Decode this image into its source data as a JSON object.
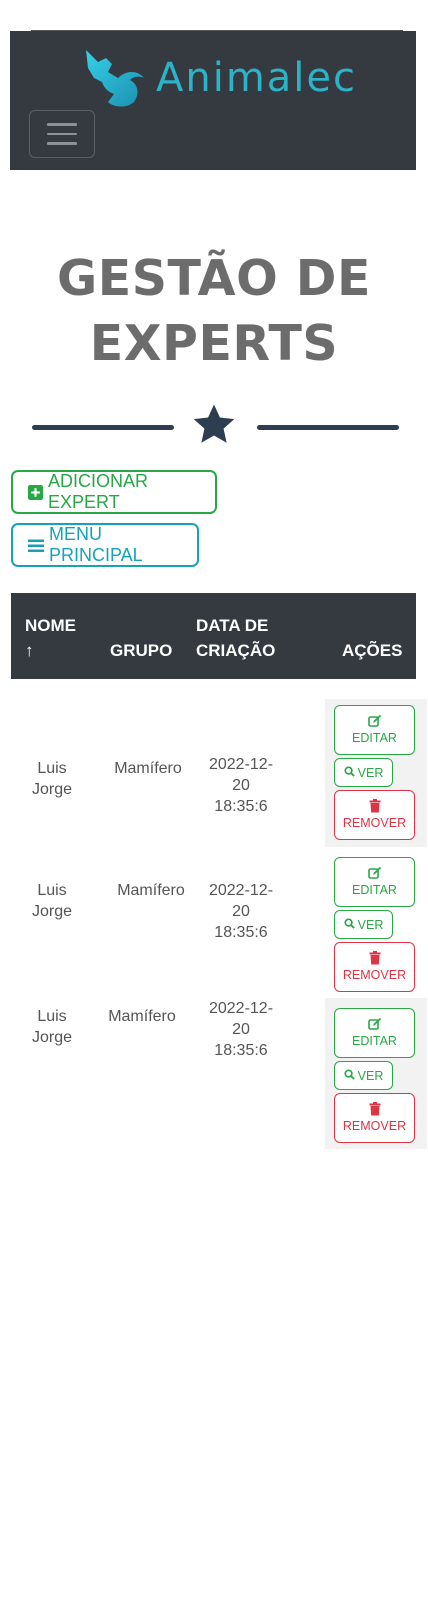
{
  "navbar": {
    "brand": "Animalec"
  },
  "title": {
    "line1": "GESTÃO DE",
    "line2": "EXPERTS"
  },
  "actions": {
    "add_label": "ADICIONAR EXPERT",
    "menu_label": "MENU PRINCIPAL"
  },
  "table": {
    "headers": {
      "nome_1": "NOME",
      "nome_arrow": "↑",
      "grupo": "GRUPO",
      "data_1": "DATA DE",
      "data_2": "CRIAÇÃO",
      "acoes": "AÇÕES"
    },
    "rows": [
      {
        "nome_1": "Luis",
        "nome_2": "Jorge",
        "grupo": "Mamífero",
        "date_1": "2022-12-",
        "date_2": "20",
        "date_3": "18:35:6"
      },
      {
        "nome_1": "Luis",
        "nome_2": "Jorge",
        "grupo": "Mamífero",
        "date_1": "2022-12-",
        "date_2": "20",
        "date_3": "18:35:6"
      },
      {
        "nome_1": "Luis",
        "nome_2": "Jorge",
        "grupo": "Mamífero",
        "date_1": "2022-12-",
        "date_2": "20",
        "date_3": "18:35:6"
      }
    ],
    "row_buttons": {
      "edit": "EDITAR",
      "view": "VER",
      "remove": "REMOVER"
    }
  },
  "colors": {
    "navbar": "#343a40",
    "brand": "#2bb3c8",
    "success": "#28a745",
    "info": "#17a2b8",
    "danger": "#dc3545",
    "star": "#2c3e50",
    "title": "#6c6c6c"
  },
  "icons": [
    "fox-logo-icon",
    "hamburger-icon",
    "star-icon",
    "plus-square-icon",
    "bars-icon",
    "edit-icon",
    "search-icon",
    "trash-icon",
    "arrow-up-icon"
  ]
}
